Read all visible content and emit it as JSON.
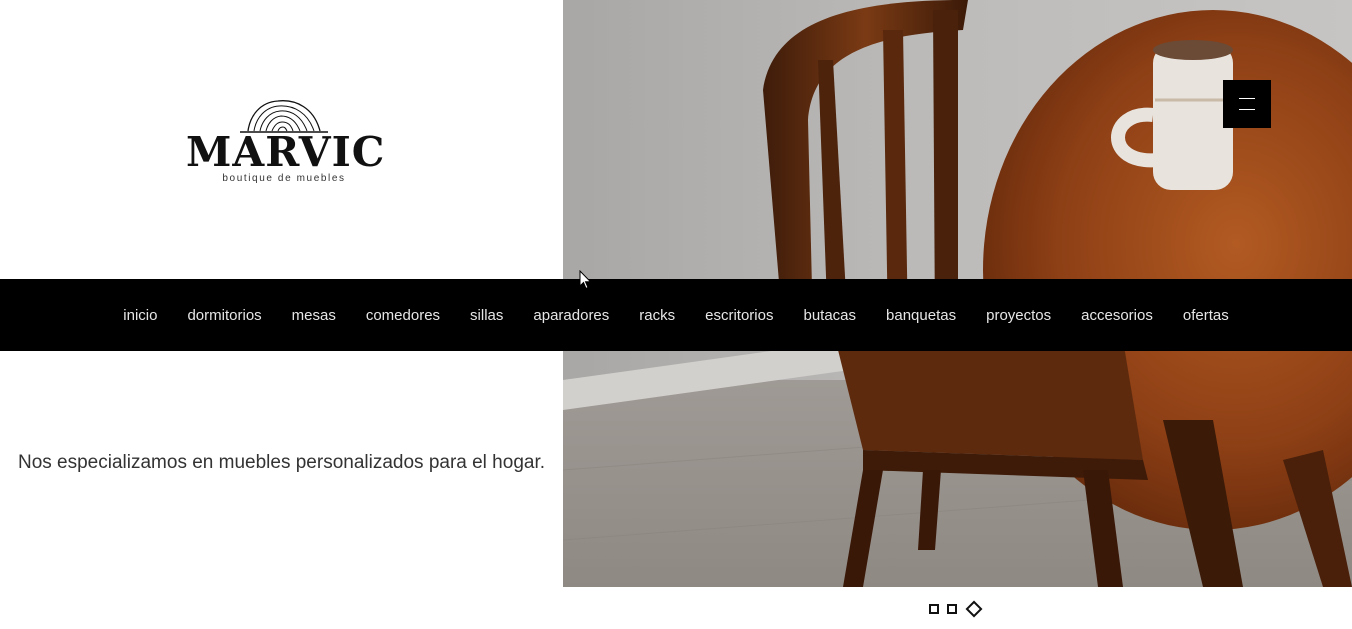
{
  "brand": {
    "name": "MARVIC",
    "tagline": "boutique de muebles"
  },
  "nav": {
    "items": [
      "inicio",
      "dormitorios",
      "mesas",
      "comedores",
      "sillas",
      "aparadores",
      "racks",
      "escritorios",
      "butacas",
      "banquetas",
      "proyectos",
      "accesorios",
      "ofertas"
    ]
  },
  "hero": {
    "text": "Nos especializamos en muebles personalizados para el hogar.",
    "image_description": "wooden chair and round table with ceramic mug",
    "slides": {
      "count": 3,
      "active": 3
    }
  },
  "colors": {
    "nav_bg": "#000000",
    "nav_text": "#e6e6e6",
    "accent": "#111111"
  },
  "icons": {
    "menu": "hamburger-icon",
    "logo": "tree-stump-icon"
  }
}
